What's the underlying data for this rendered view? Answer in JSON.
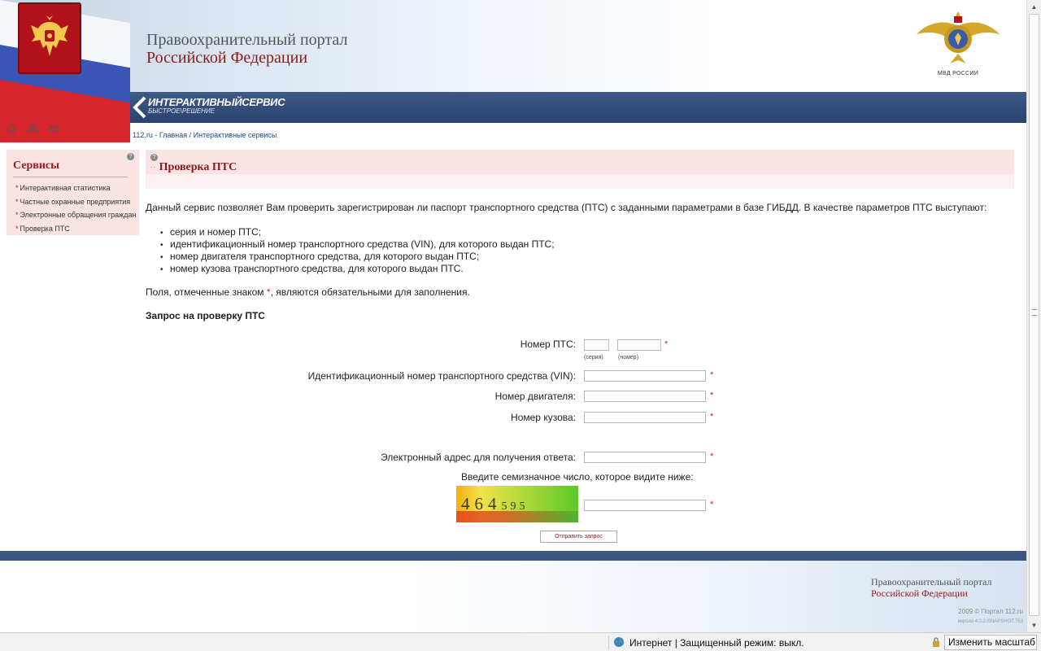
{
  "header": {
    "portal_title_line1": "Правоохранительный портал",
    "portal_title_line2": "Российской Федерации",
    "band_title": "ИНТЕРАКТИВНЫЙСЕРВИС",
    "band_subtitle": "БЫСТРОЕ\\РЕШЕНИЕ",
    "mvd_label": "МВД РОССИИ",
    "icons": [
      "home-icon",
      "sitemap-icon",
      "mail-icon"
    ]
  },
  "breadcrumb": {
    "site": "112.ru",
    "sep1": " - ",
    "home": "Главная",
    "sep2": " / ",
    "current": "Интерактивные сервисы"
  },
  "sidebar": {
    "title": "Сервисы",
    "help": "?",
    "items": [
      "Интерактивная статистика",
      "Частные охранные предприятия",
      "Электронные обращения граждан",
      "Проверка ПТС"
    ]
  },
  "main": {
    "title": "Проверка ПТС",
    "help": "?",
    "intro": "Данный сервис позволяет Вам проверить зарегистрирован ли паспорт транспортного средства (ПТС) с заданными параметрами в базе ГИБДД. В качестве параметров ПТС выступают:",
    "bullets": [
      "серия и номер ПТС;",
      "идентификационный номер транспортного средства (VIN), для которого выдан ПТС;",
      "номер двигателя транспортного средства, для которого выдан ПТС;",
      "номер кузова транспортного средства, для которого выдан ПТС."
    ],
    "required_note_before": "Поля, отмеченные знаком ",
    "required_mark": "*",
    "required_note_after": ", являются обязательными для заполнения.",
    "form_title": "Запрос на проверку ПТС"
  },
  "form": {
    "pts_label": "Номер ПТС:",
    "pts_series_hint": "(серия)",
    "pts_number_hint": "(номер)",
    "pts_series_value": "",
    "pts_number_value": "",
    "vin_label": "Идентификационный номер транспортного средства (VIN):",
    "vin_value": "",
    "engine_label": "Номер двигателя:",
    "engine_value": "",
    "body_label": "Номер кузова:",
    "body_value": "",
    "email_label": "Электронный адрес для получения ответа:",
    "email_value": "",
    "captcha_prompt": "Введите семизначное число, которое видите ниже:",
    "captcha_main": "464",
    "captcha_tail": "595",
    "captcha_value": "",
    "required_mark": "*",
    "submit_label": "Отправить запрос"
  },
  "footer": {
    "title_line1": "Правоохранительный портал",
    "title_line2": "Российской Федерации",
    "copyright": "2009 © Портал 112.ru",
    "version": "версия 4.0.2-SNAPSHOT.753"
  },
  "statusbar": {
    "zone": "Интернет | Защищенный режим: выкл.",
    "zoom_label": "Изменить масштаб"
  },
  "colors": {
    "accent_red": "#8b1a1a",
    "panel_pink": "#f9e3e3",
    "band_blue": "#2f4a7a",
    "link_blue": "#1f4a87"
  }
}
